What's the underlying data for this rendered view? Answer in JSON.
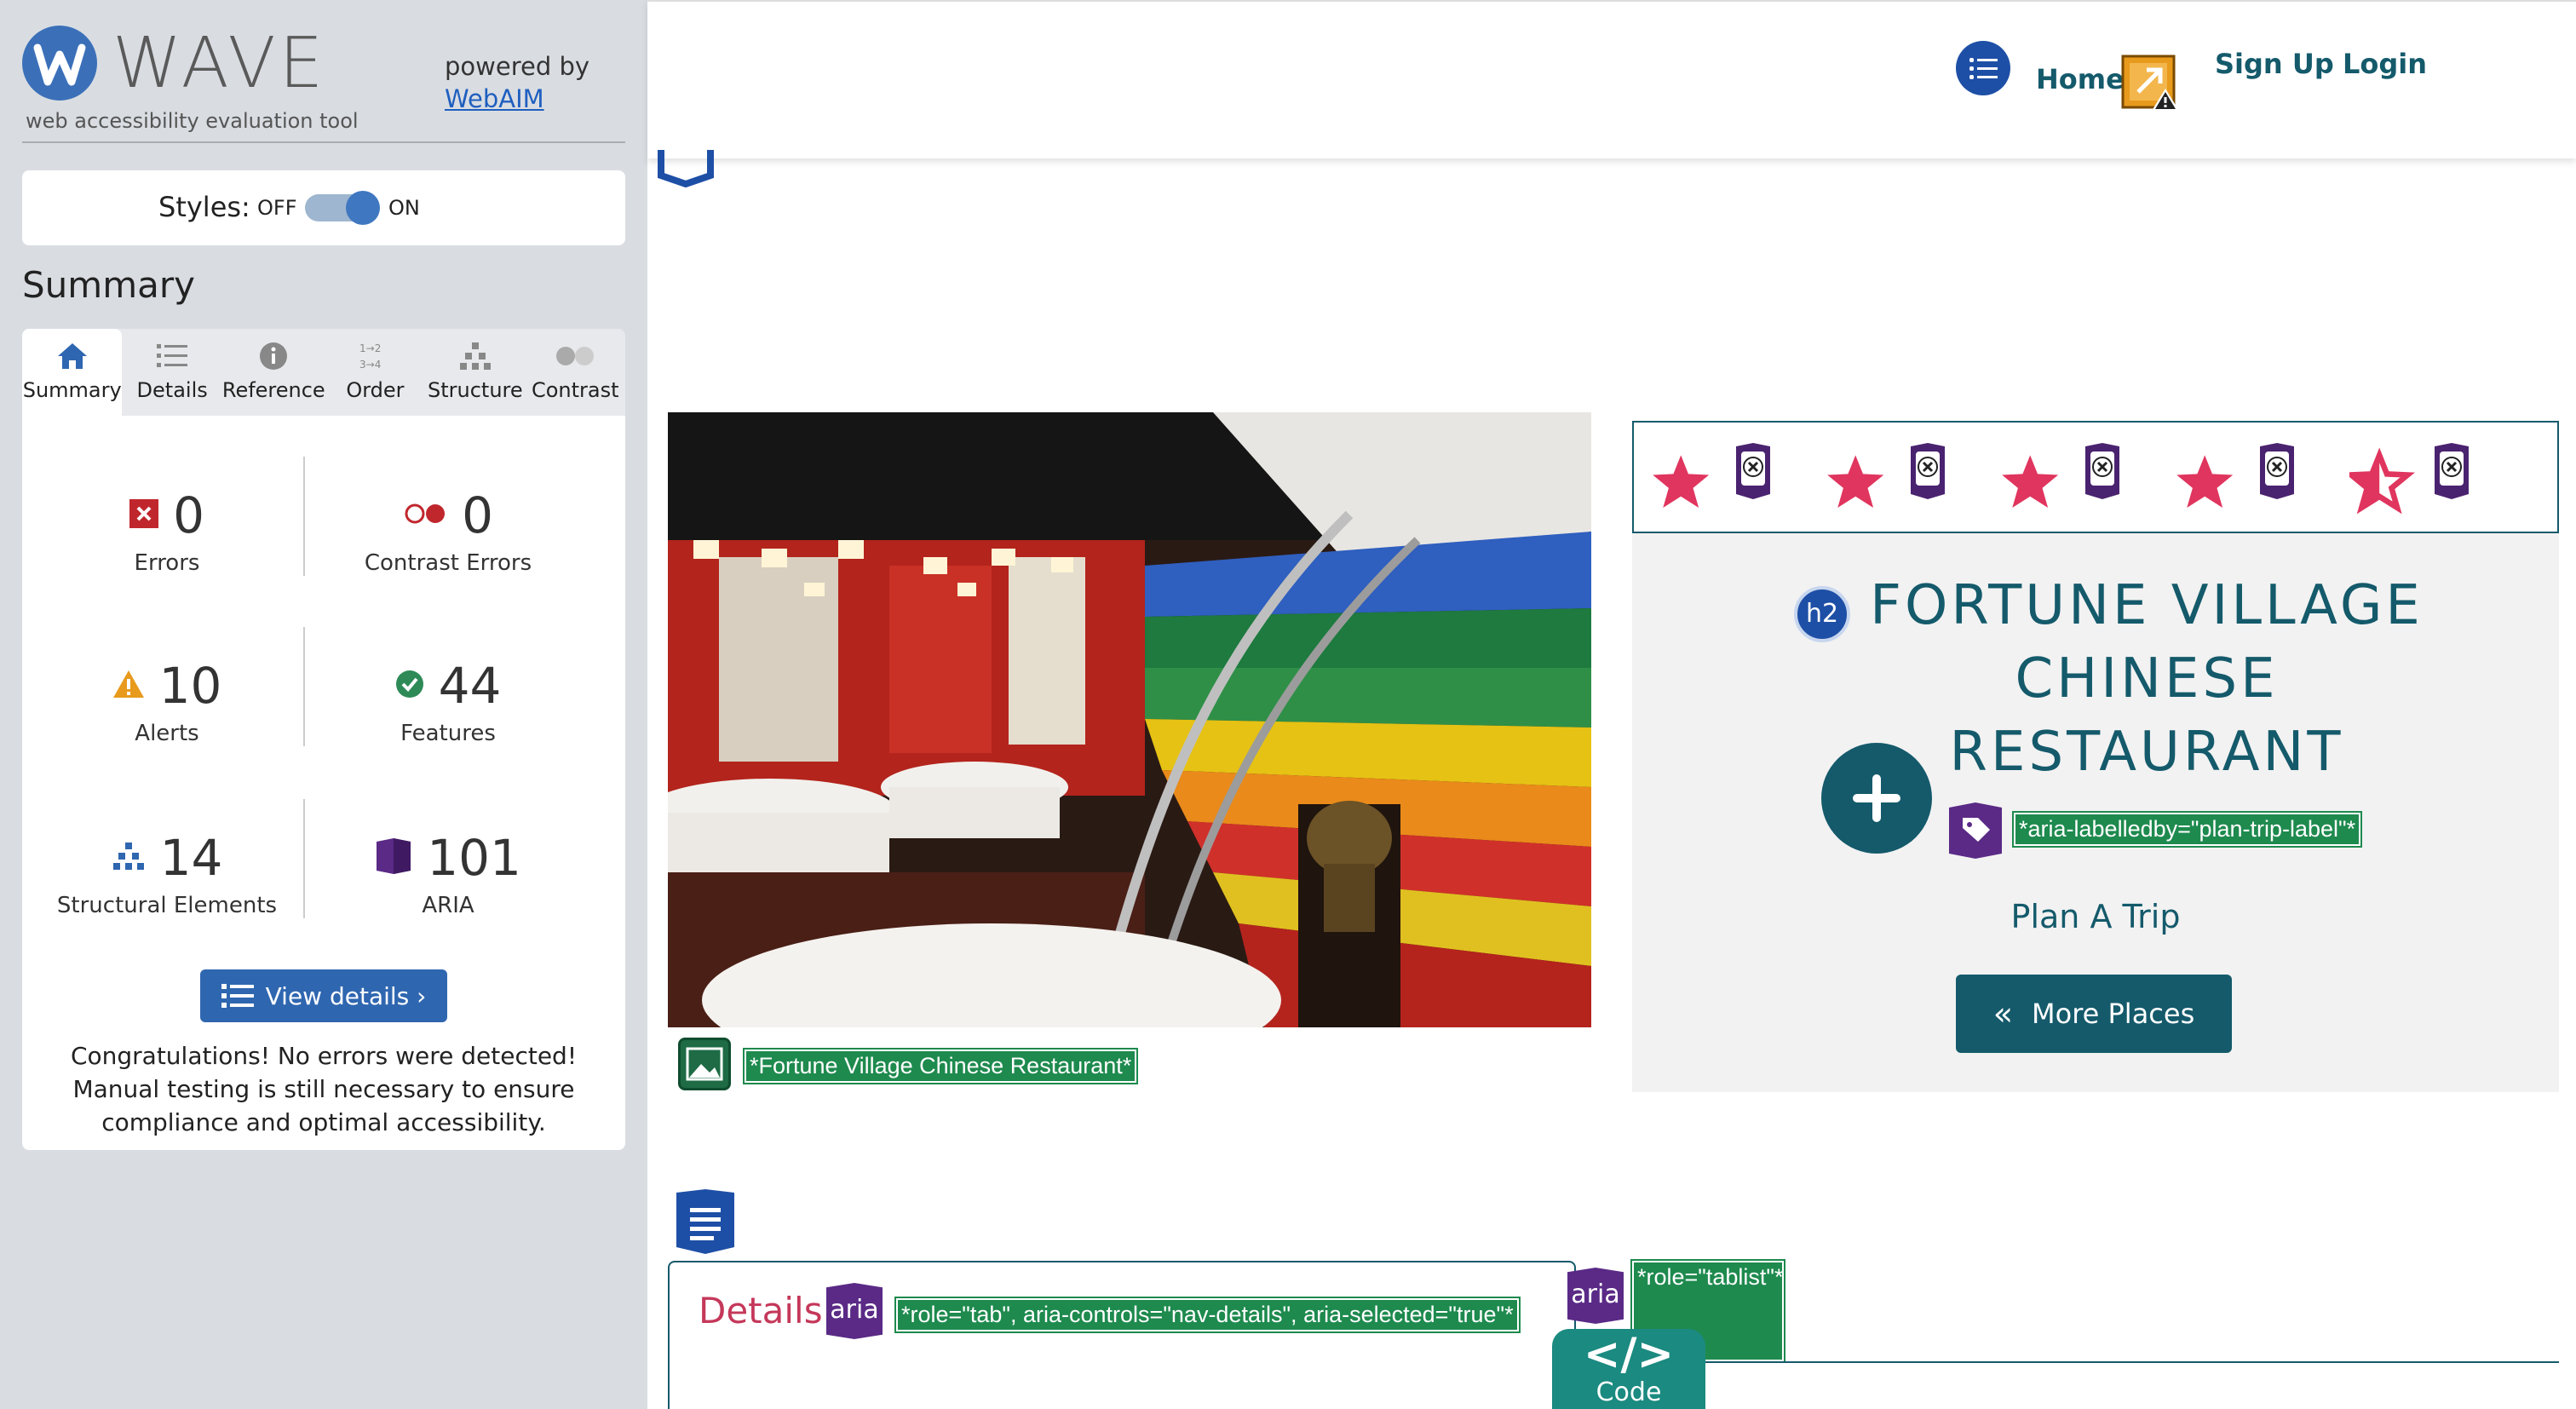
{
  "wave": {
    "logo_text": "WAVE",
    "subtitle": "web accessibility evaluation tool",
    "powered_by": "powered by",
    "powered_link": "WebAIM",
    "styles_label": "Styles:",
    "styles_off": "OFF",
    "styles_on": "ON",
    "styles_enabled": true,
    "summary_title": "Summary",
    "tabs": [
      {
        "label": "Summary",
        "icon": "home-icon",
        "active": true
      },
      {
        "label": "Details",
        "icon": "list-icon",
        "active": false
      },
      {
        "label": "Reference",
        "icon": "info-icon",
        "active": false
      },
      {
        "label": "Order",
        "icon": "order-icon",
        "active": false
      },
      {
        "label": "Structure",
        "icon": "structure-icon",
        "active": false
      },
      {
        "label": "Contrast",
        "icon": "contrast-icon",
        "active": false
      }
    ],
    "stats": {
      "errors": {
        "value": "0",
        "label": "Errors",
        "color": "#c0272d"
      },
      "contrast_errors": {
        "value": "0",
        "label": "Contrast Errors",
        "color": "#c0272d"
      },
      "alerts": {
        "value": "10",
        "label": "Alerts",
        "color": "#e89a1c"
      },
      "features": {
        "value": "44",
        "label": "Features",
        "color": "#2e8b57"
      },
      "structural": {
        "value": "14",
        "label": "Structural Elements",
        "color": "#2f66b0"
      },
      "aria": {
        "value": "101",
        "label": "ARIA",
        "color": "#5a2a86"
      }
    },
    "view_details": "View details ›",
    "congrats": "Congratulations! No errors were detected! Manual testing is still necessary to ensure compliance and optimal accessibility."
  },
  "page": {
    "nav": {
      "home": "Home",
      "signup": "Sign Up",
      "login": "Login"
    },
    "image_alt_note": "*Fortune Village Chinese Restaurant*",
    "rating": {
      "filled": 4,
      "total": 5
    },
    "h2_badge": "h2",
    "title": "FORTUNE VILLAGE CHINESE RESTAURANT",
    "aria_labelledby_note": "*aria-labelledby=\"plan-trip-label\"*",
    "plan_trip": "Plan A Trip",
    "more_places": "More Places",
    "details_tab": "Details",
    "aria_badge": "aria",
    "tab_note": "*role=\"tab\", aria-controls=\"nav-details\", aria-selected=\"true\"*",
    "tablist_note": "*role=\"tablist\"*",
    "code_symbol": "</>",
    "code_label": "Code",
    "accent": "#145a6b",
    "star_color": "#e0355e"
  }
}
